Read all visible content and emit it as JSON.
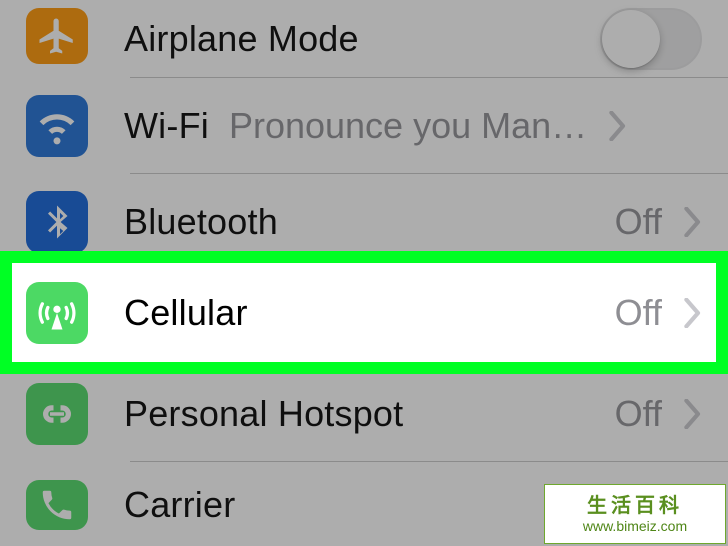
{
  "rows": {
    "airplane": {
      "label": "Airplane Mode"
    },
    "wifi": {
      "label": "Wi-Fi",
      "detail": "Pronounce you Man…"
    },
    "bluetooth": {
      "label": "Bluetooth",
      "detail": "Off"
    },
    "cellular": {
      "label": "Cellular",
      "detail": "Off"
    },
    "hotspot": {
      "label": "Personal Hotspot",
      "detail": "Off"
    },
    "carrier": {
      "label": "Carrier"
    }
  },
  "highlight": {
    "row": "cellular"
  },
  "watermark": {
    "title": "生活百科",
    "url": "www.bimeiz.com"
  },
  "colors": {
    "highlight_border": "#00ff24"
  }
}
